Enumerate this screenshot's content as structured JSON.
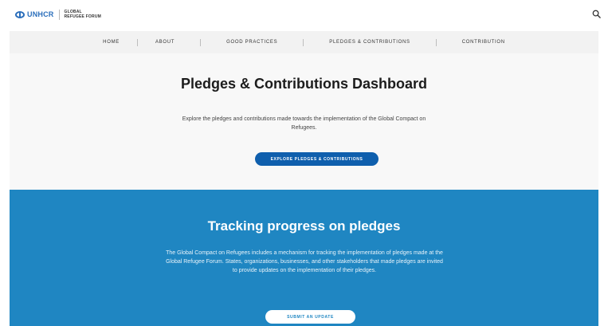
{
  "header": {
    "logo_text": "UNHCR",
    "logo_sub_line1": "GLOBAL",
    "logo_sub_line2": "REFUGEE FORUM",
    "search_icon": "search-icon"
  },
  "nav": {
    "items": [
      {
        "label": "HOME"
      },
      {
        "label": "ABOUT"
      },
      {
        "label": "GOOD PRACTICES"
      },
      {
        "label": "PLEDGES & CONTRIBUTIONS"
      },
      {
        "label": "CONTRIBUTION"
      }
    ]
  },
  "hero": {
    "title": "Pledges & Contributions Dashboard",
    "description": "Explore the pledges and contributions made towards the implementation of the Global Compact on Refugees.",
    "button_label": "EXPLORE PLEDGES & CONTRIBUTIONS"
  },
  "tracking": {
    "title": "Tracking progress on pledges",
    "description": "The Global Compact on Refugees includes a mechanism for tracking the implementation of pledges made at the Global Refugee Forum. States, organizations, businesses, and other stakeholders that made pledges are invited to provide updates on the implementation of their pledges.",
    "button_label": "SUBMIT AN UPDATE"
  },
  "colors": {
    "brand_blue": "#1f86c2",
    "button_blue": "#0f5fad",
    "nav_bg": "#f2f2f2"
  }
}
